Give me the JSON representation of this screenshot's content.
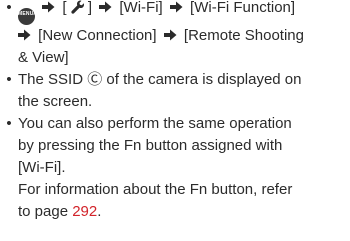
{
  "steps": {
    "menu_button_text": "MENU/SET",
    "menu_open": "[",
    "menu_close": "]",
    "wifi": "[Wi-Fi]",
    "wifi_function": "[Wi-Fi Function]",
    "new_connection": "[New Connection]",
    "remote_shooting": "[Remote Shooting",
    "and_view": "& View]"
  },
  "notes": {
    "bullet": "•",
    "ssid_part1": "The SSID ",
    "ssid_symbol": "Ⓒ",
    "ssid_part2": " of the camera is displayed on",
    "ssid_line2": "the screen.",
    "fn_line1": "You can also perform the same operation",
    "fn_line2": "by pressing the Fn button assigned with",
    "fn_line3": "[Wi-Fi].",
    "fn_line4": "For information about the Fn button, refer",
    "fn_line5_prefix": "to page ",
    "fn_page": "292",
    "fn_line5_suffix": "."
  },
  "colors": {
    "link": "#d2232a",
    "text": "#2b2b2b"
  }
}
